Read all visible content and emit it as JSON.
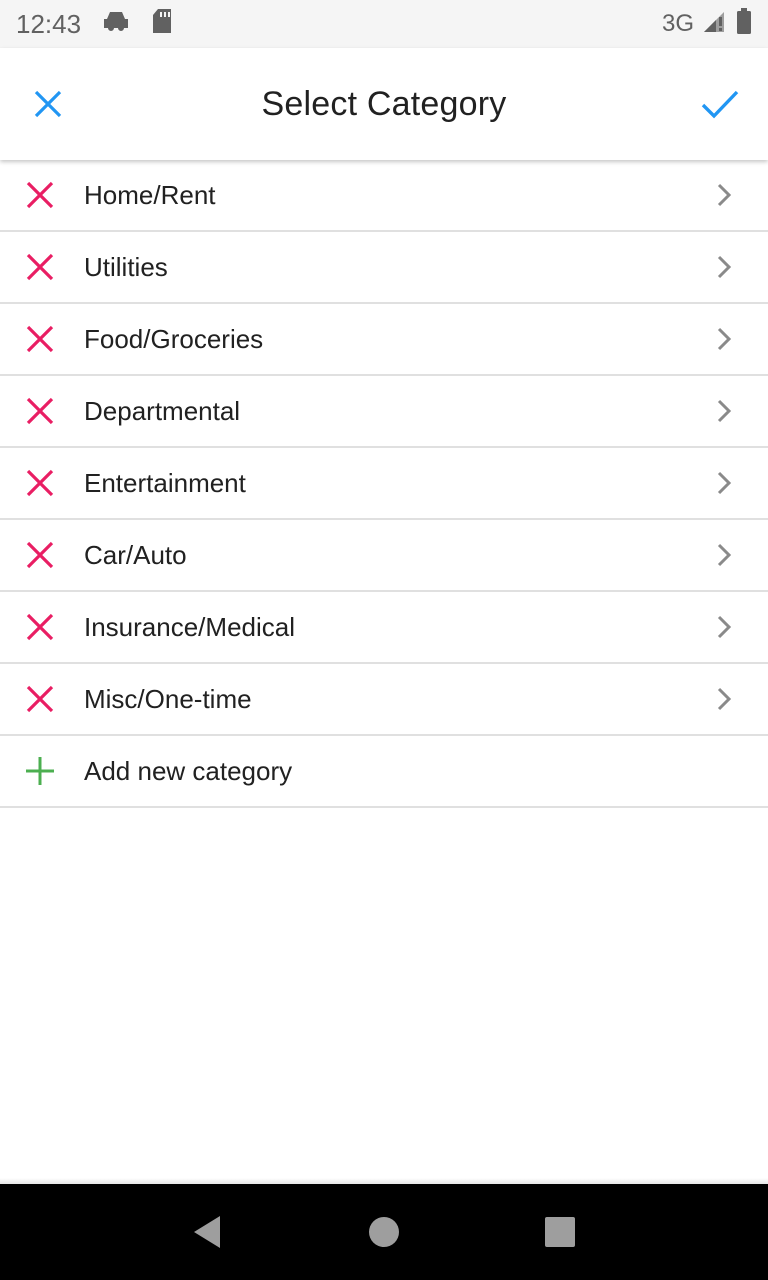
{
  "status_bar": {
    "time": "12:43",
    "network": "3G",
    "icons": [
      "car-notification-icon",
      "sd-card-icon",
      "signal-icon",
      "battery-icon"
    ]
  },
  "app_bar": {
    "title": "Select Category",
    "close_icon": "close-icon",
    "confirm_icon": "check-icon",
    "accent_color": "#2196f3"
  },
  "categories": [
    {
      "label": "Home/Rent"
    },
    {
      "label": "Utilities"
    },
    {
      "label": "Food/Groceries"
    },
    {
      "label": "Departmental"
    },
    {
      "label": "Entertainment"
    },
    {
      "label": "Car/Auto"
    },
    {
      "label": "Insurance/Medical"
    },
    {
      "label": "Misc/One-time"
    }
  ],
  "add_row": {
    "label": "Add new category",
    "icon": "plus-icon"
  },
  "colors": {
    "delete": "#e91e63",
    "add": "#4caf50",
    "chevron": "#8a8a8a"
  },
  "nav_bar": {
    "icons": [
      "back-icon",
      "home-icon",
      "recents-icon"
    ]
  }
}
